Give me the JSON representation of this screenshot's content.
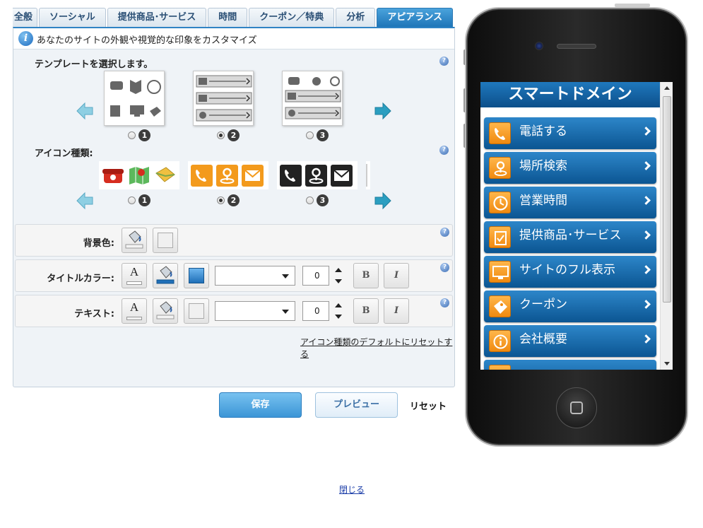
{
  "tabs": [
    {
      "label": "全般",
      "active": false
    },
    {
      "label": "ソーシャル",
      "active": false
    },
    {
      "label": "提供商品･サービス",
      "active": false
    },
    {
      "label": "時間",
      "active": false
    },
    {
      "label": "クーポン／特典",
      "active": false
    },
    {
      "label": "分析",
      "active": false
    },
    {
      "label": "アピアランス",
      "active": true
    }
  ],
  "info": {
    "text": "あなたのサイトの外観や視覚的な印象をカスタマイズ"
  },
  "template_section": {
    "label": "テンプレートを選択します。",
    "options": [
      "1",
      "2",
      "3"
    ],
    "selected": "2"
  },
  "icon_section": {
    "label": "アイコン種類:",
    "options": [
      "1",
      "2",
      "3"
    ],
    "selected": "2"
  },
  "background": {
    "label": "背景色:"
  },
  "title_color": {
    "label": "タイトルカラー:",
    "size_value": "0",
    "bold": "B",
    "italic": "I"
  },
  "text_color": {
    "label": "テキスト:",
    "size_value": "0",
    "bold": "B",
    "italic": "I",
    "font_a": "A"
  },
  "reset_icons_link": "アイコン種類のデフォルトにリセットする",
  "buttons": {
    "save": "保存",
    "preview": "プレビュー",
    "reset": "リセット"
  },
  "close_link": "閉じる",
  "help_glyph": "?",
  "info_glyph": "i",
  "phone": {
    "title": "スマートドメイン",
    "menu": [
      {
        "label": "電話する",
        "icon": "phone-icon"
      },
      {
        "label": "場所検索",
        "icon": "map-pin-icon"
      },
      {
        "label": "営業時間",
        "icon": "clock-icon"
      },
      {
        "label": "提供商品･サービス",
        "icon": "clipboard-icon"
      },
      {
        "label": "サイトのフル表示",
        "icon": "monitor-icon"
      },
      {
        "label": "クーポン",
        "icon": "tag-icon"
      },
      {
        "label": "会社概要",
        "icon": "info-icon"
      }
    ]
  },
  "colors": {
    "accent": "#2f83c4",
    "menu_top": "#2d86c9",
    "menu_bottom": "#0b5592",
    "icon_orange": "#f08a10",
    "title_swatch": "#3b8ed4"
  }
}
